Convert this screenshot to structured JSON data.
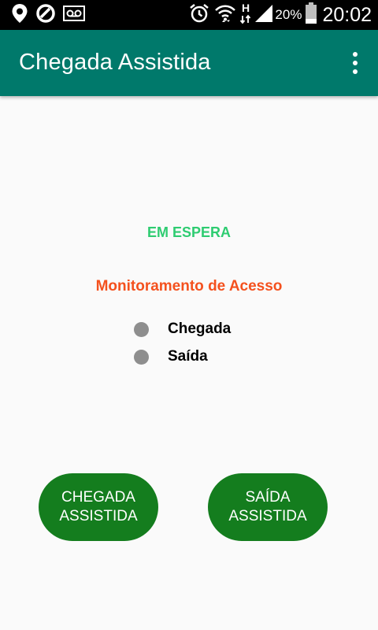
{
  "status_bar": {
    "icons_left": [
      "location-pin-icon",
      "do-not-disturb-icon",
      "voicemail-icon"
    ],
    "icons_right": [
      "alarm-icon",
      "wifi-icon",
      "h-signal-icon",
      "cell-signal-icon",
      "battery-icon"
    ],
    "network_type": "H",
    "battery_percent": "20%",
    "time": "20:02"
  },
  "app_bar": {
    "title": "Chegada Assistida",
    "menu_icon": "more-vert-icon",
    "color": "#00796B"
  },
  "main": {
    "status": "EM ESPERA",
    "status_color": "#2ECC71",
    "monitor_title": "Monitoramento de Acesso",
    "monitor_color": "#F4511E",
    "indicators": [
      {
        "label": "Chegada",
        "color": "#8E8E8E"
      },
      {
        "label": "Saída",
        "color": "#8E8E8E"
      }
    ],
    "buttons": [
      {
        "label": "CHEGADA\nASSISTIDA"
      },
      {
        "label": "SAÍDA\nASSISTIDA"
      }
    ],
    "button_color": "#147D1E"
  }
}
